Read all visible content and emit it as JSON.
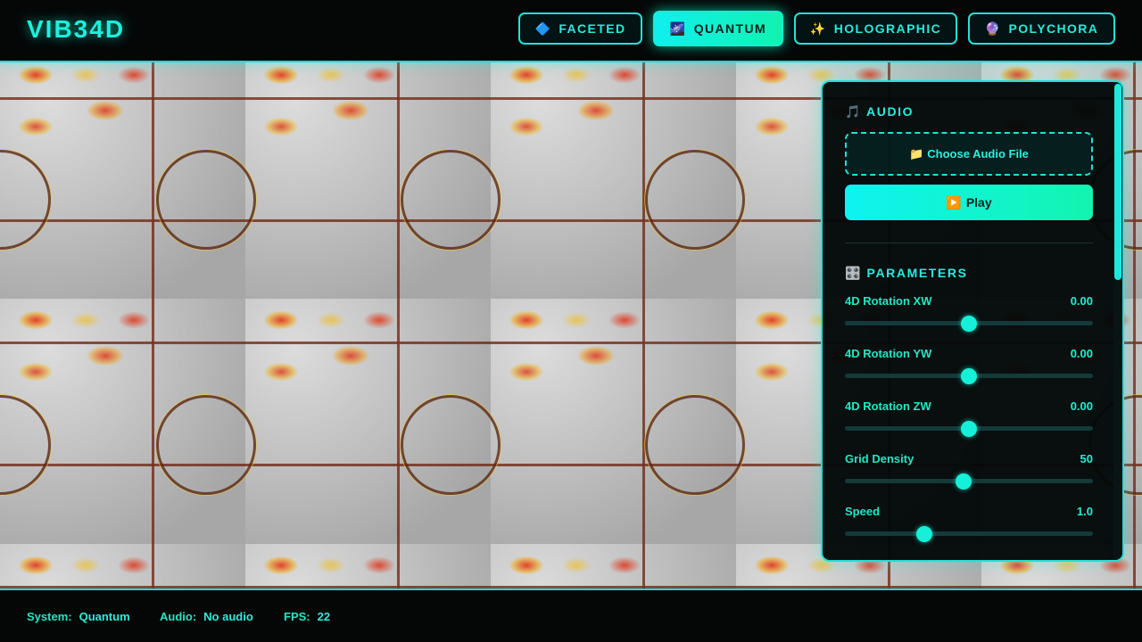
{
  "app": {
    "logo": "VIB34D"
  },
  "tabs": [
    {
      "icon": "🔷",
      "label": "FACETED",
      "active": false
    },
    {
      "icon": "🌌",
      "label": "QUANTUM",
      "active": true
    },
    {
      "icon": "✨",
      "label": "HOLOGRAPHIC",
      "active": false
    },
    {
      "icon": "🔮",
      "label": "POLYCHORA",
      "active": false
    }
  ],
  "panel": {
    "audio": {
      "title_icon": "🎵",
      "title": "AUDIO",
      "file_icon": "📁",
      "file_label": "Choose Audio File",
      "play_icon": "▶️",
      "play_label": "Play"
    },
    "parameters": {
      "title_icon": "🎛️",
      "title": "PARAMETERS",
      "items": [
        {
          "label": "4D Rotation XW",
          "value": "0.00",
          "fraction": 0.5
        },
        {
          "label": "4D Rotation YW",
          "value": "0.00",
          "fraction": 0.5
        },
        {
          "label": "4D Rotation ZW",
          "value": "0.00",
          "fraction": 0.5
        },
        {
          "label": "Grid Density",
          "value": "50",
          "fraction": 0.48
        },
        {
          "label": "Speed",
          "value": "1.0",
          "fraction": 0.32
        }
      ]
    }
  },
  "status": {
    "system_label": "System:",
    "system_value": "Quantum",
    "audio_label": "Audio:",
    "audio_value": "No audio",
    "fps_label": "FPS:",
    "fps_value": "22"
  },
  "colors": {
    "accent": "#21e3d6",
    "accent_green": "#13f4b0",
    "panel_bg": "#030808"
  }
}
